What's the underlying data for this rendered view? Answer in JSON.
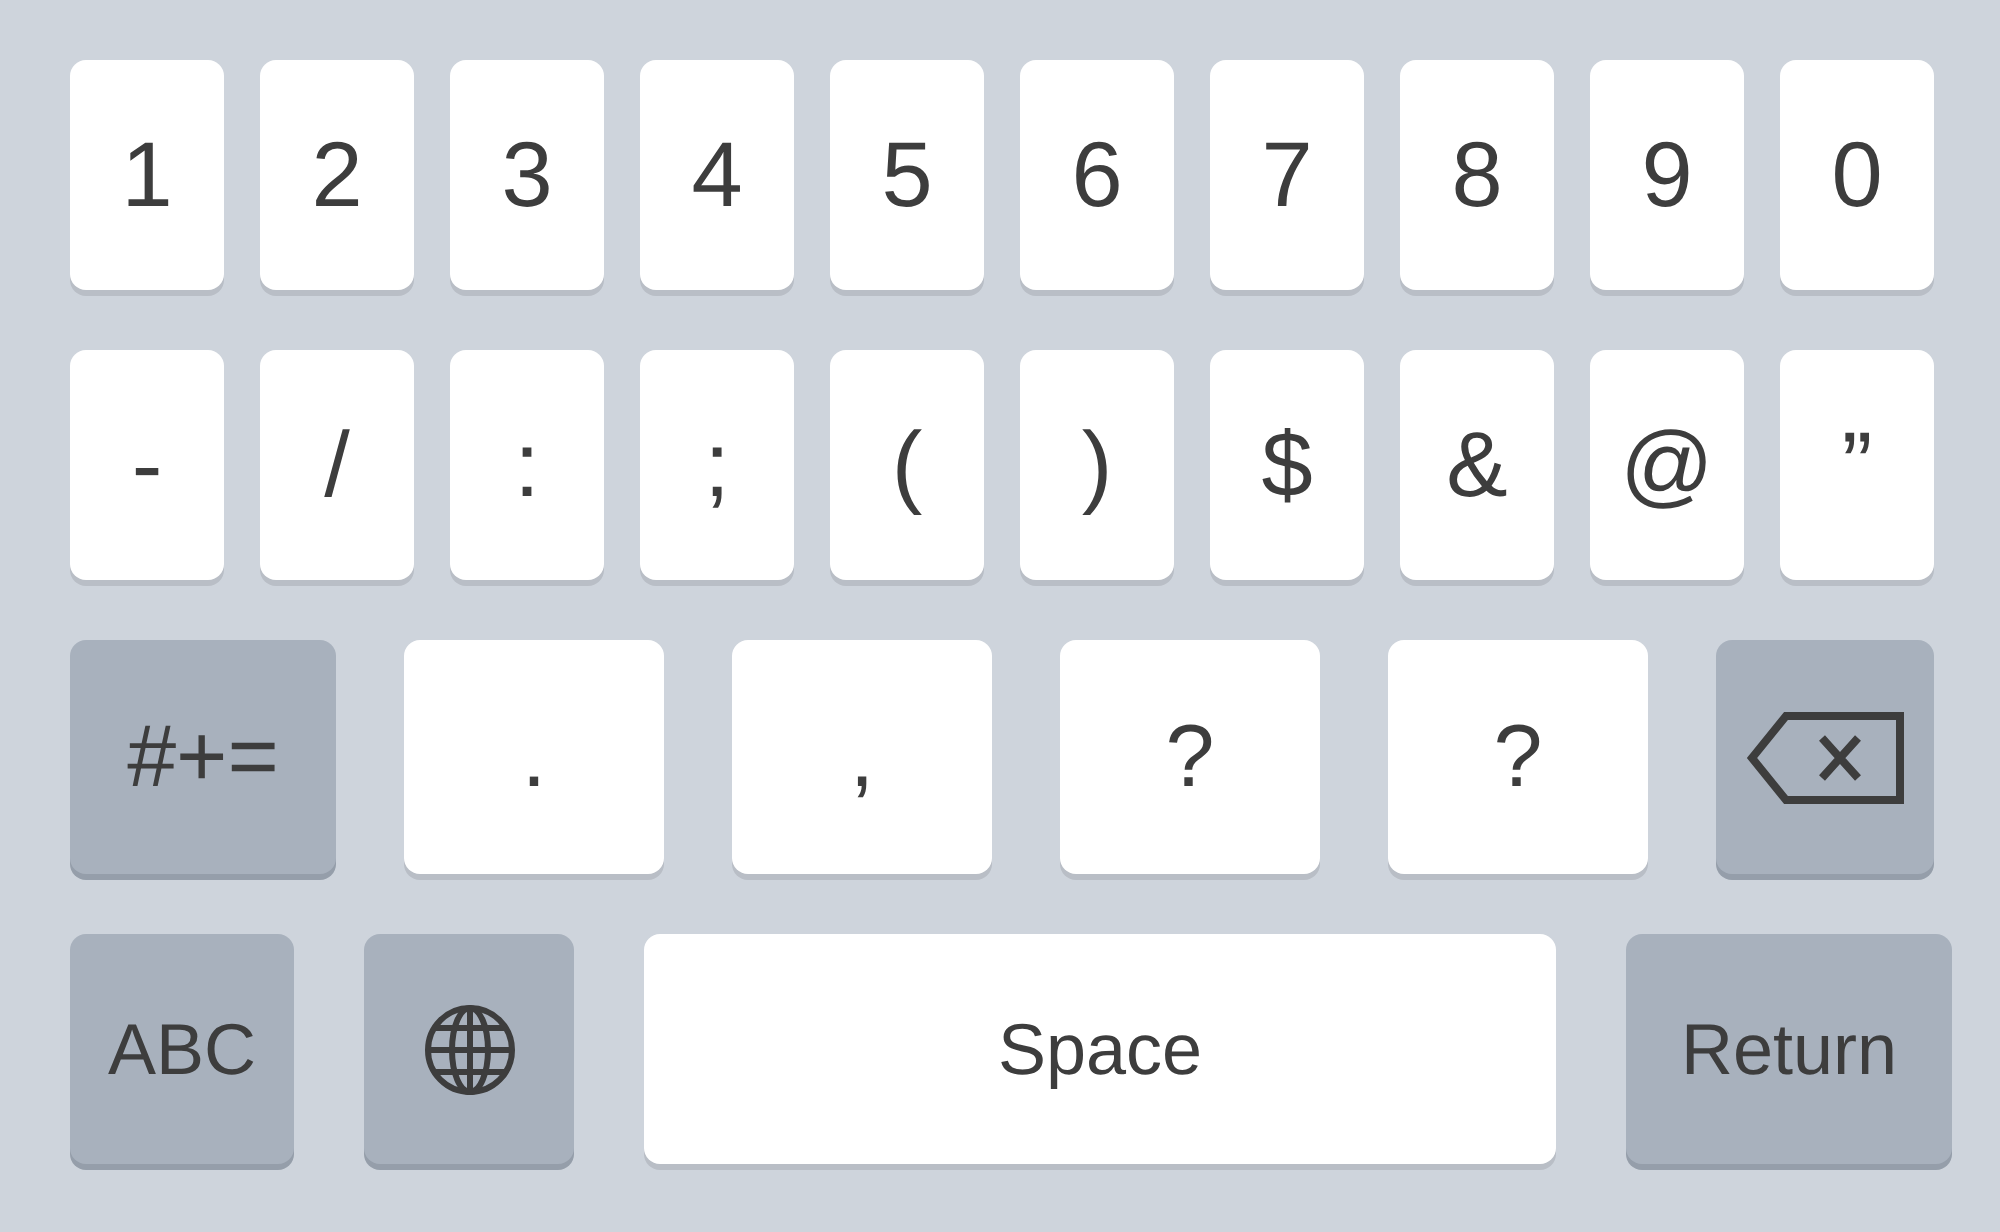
{
  "keyboard": {
    "rows": [
      {
        "keys": [
          {
            "kind": "char",
            "label": "1"
          },
          {
            "kind": "char",
            "label": "2"
          },
          {
            "kind": "char",
            "label": "3"
          },
          {
            "kind": "char",
            "label": "4"
          },
          {
            "kind": "char",
            "label": "5"
          },
          {
            "kind": "char",
            "label": "6"
          },
          {
            "kind": "char",
            "label": "7"
          },
          {
            "kind": "char",
            "label": "8"
          },
          {
            "kind": "char",
            "label": "9"
          },
          {
            "kind": "char",
            "label": "0"
          }
        ]
      },
      {
        "keys": [
          {
            "kind": "char",
            "label": "-"
          },
          {
            "kind": "char",
            "label": "/"
          },
          {
            "kind": "char",
            "label": ":"
          },
          {
            "kind": "char",
            "label": ";"
          },
          {
            "kind": "char",
            "label": "("
          },
          {
            "kind": "char",
            "label": ")"
          },
          {
            "kind": "char",
            "label": "$"
          },
          {
            "kind": "char",
            "label": "&"
          },
          {
            "kind": "char",
            "label": "@"
          },
          {
            "kind": "char",
            "label": "”"
          }
        ]
      },
      {
        "keys": [
          {
            "kind": "function",
            "label": "#+="
          },
          {
            "kind": "char",
            "label": "."
          },
          {
            "kind": "char",
            "label": ","
          },
          {
            "kind": "char",
            "label": "?"
          },
          {
            "kind": "char",
            "label": "?"
          },
          {
            "kind": "backspace"
          }
        ]
      },
      {
        "keys": [
          {
            "kind": "function",
            "label": "ABC"
          },
          {
            "kind": "globe"
          },
          {
            "kind": "space",
            "label": "Space"
          },
          {
            "kind": "function",
            "label": "Return"
          }
        ]
      }
    ]
  }
}
